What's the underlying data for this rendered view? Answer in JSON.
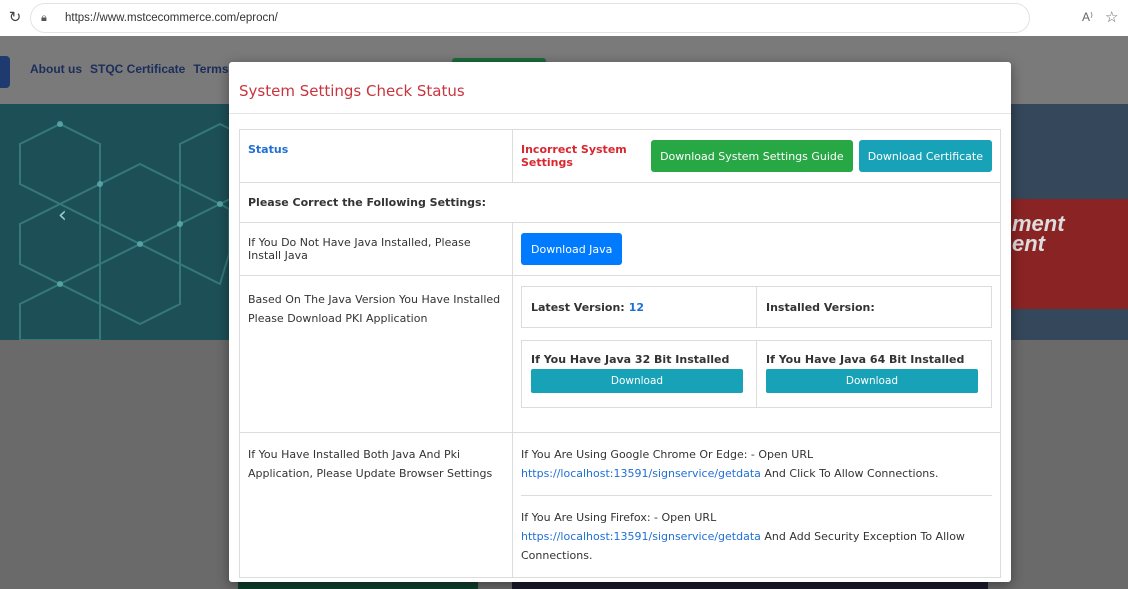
{
  "browser": {
    "url": "https://www.mstcecommerce.com/eprocn/",
    "reload_icon": "reload-icon",
    "read_aloud_label": "A⁾"
  },
  "nav": {
    "links": [
      "About us",
      "STQC Certificate",
      "Terms of"
    ]
  },
  "hero": {
    "right_text_1": "ment",
    "right_text_2": "ent"
  },
  "modal": {
    "title": "System Settings Check Status",
    "status": {
      "label": "Status",
      "value": "Incorrect System Settings",
      "guide_button": "Download System Settings Guide",
      "certificate_button": "Download Certificate"
    },
    "correct_heading": "Please Correct the Following Settings:",
    "java": {
      "text": "If You Do Not Have Java Installed, Please Install Java",
      "button": "Download Java"
    },
    "pki": {
      "text": "Based On The Java Version You Have Installed Please Download PKI Application",
      "latest_label": "Latest Version:",
      "latest_value": "12",
      "installed_label": "Installed Version:",
      "bit32_label": "If You Have Java 32 Bit Installed",
      "bit64_label": "If You Have Java 64 Bit Installed",
      "download_label": "Download"
    },
    "browser_settings": {
      "text": "If You Have Installed Both Java And Pki Application, Please Update Browser Settings",
      "chrome_prefix": "If You Are Using Google Chrome Or Edge: - Open URL",
      "chrome_url": "https://localhost:13591/signservice/getdata",
      "chrome_suffix": "And Click To Allow Connections.",
      "firefox_prefix": "If You Are Using Firefox: - Open URL",
      "firefox_url": "https://localhost:13591/signservice/getdata",
      "firefox_suffix": "And Add Security Exception To Allow Connections."
    }
  },
  "colors": {
    "title_red": "#c8353f",
    "link_blue": "#1f6fd6",
    "green_button": "#28a745",
    "teal_button": "#17a2b8",
    "blue_button": "#007bff"
  }
}
